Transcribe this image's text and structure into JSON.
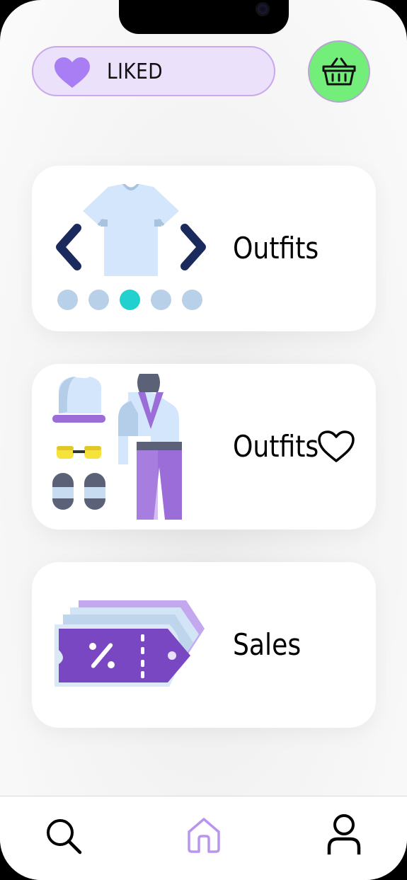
{
  "header": {
    "liked_label": "LIKED"
  },
  "cards": [
    {
      "label": "Outfits",
      "carousel": {
        "dot_count": 5,
        "active_index": 2
      }
    },
    {
      "label": "Outfits"
    },
    {
      "label": "Sales"
    }
  ],
  "nav": {
    "items": [
      {
        "icon": "search-icon",
        "active": false
      },
      {
        "icon": "home-icon",
        "active": true
      },
      {
        "icon": "profile-icon",
        "active": false
      }
    ]
  },
  "colors": {
    "liked_pill_bg": "#ece1fa",
    "liked_pill_border": "#c9a8ec",
    "heart_purple": "#a97ef5",
    "basket_bg": "#74ee7b",
    "carousel_dot": "#b8d0e8",
    "carousel_dot_active": "#21d1cf",
    "chevron": "#1b2a5c",
    "nav_active": "#b995f0"
  }
}
